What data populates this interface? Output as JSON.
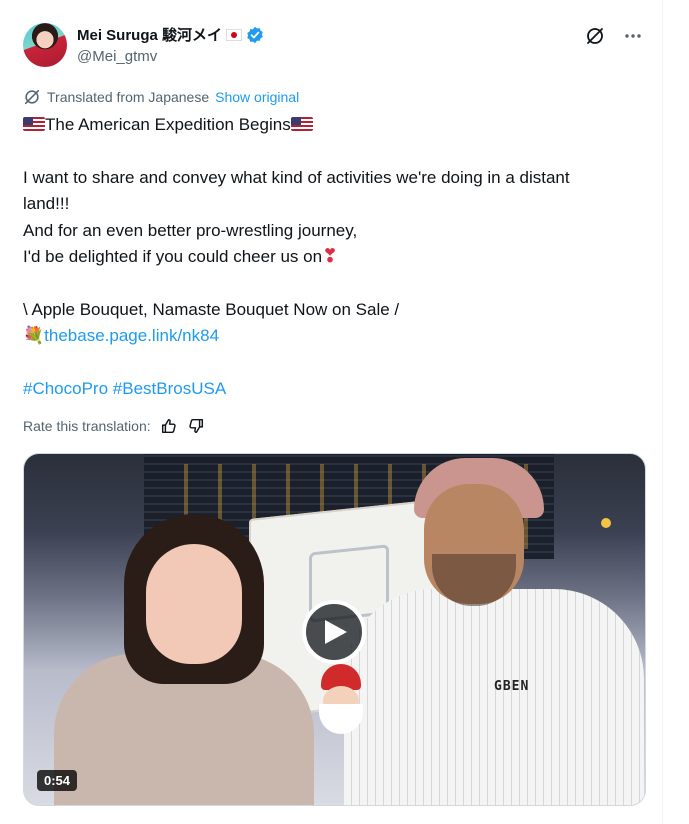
{
  "author": {
    "display_name": "Mei Suruga 駿河メイ",
    "handle": "@Mei_gtmv",
    "flag_icon": "japan-flag-icon",
    "verified_color": "#1d9bf0"
  },
  "top_actions": {
    "grok_icon": "grok-icon",
    "more_icon": "more-horizontal-icon"
  },
  "translation": {
    "translated_label": "Translated from Japanese",
    "show_original_label": "Show original",
    "rate_label": "Rate this translation:"
  },
  "tweet": {
    "line1": "The American Expedition Begins",
    "line2": "I want to share and convey what kind of activities we're doing in a distant",
    "line3": "land!!!",
    "line4": "And for an even better pro-wrestling journey,",
    "line5": "I'd be delighted if you could cheer us on",
    "line6": " \\ Apple Bouquet, Namaste Bouquet Now on Sale /",
    "link": "thebase.page.link/nk84",
    "hashtag1": "#ChocoPro",
    "hashtag2": "#BestBrosUSA",
    "heart_glyph": "❣",
    "bouquet_glyph": "💐"
  },
  "media": {
    "duration": "0:54",
    "brand_text": "GBEN"
  },
  "colors": {
    "link": "#1d9bf0",
    "text": "#0f1419",
    "secondary": "#536471"
  }
}
